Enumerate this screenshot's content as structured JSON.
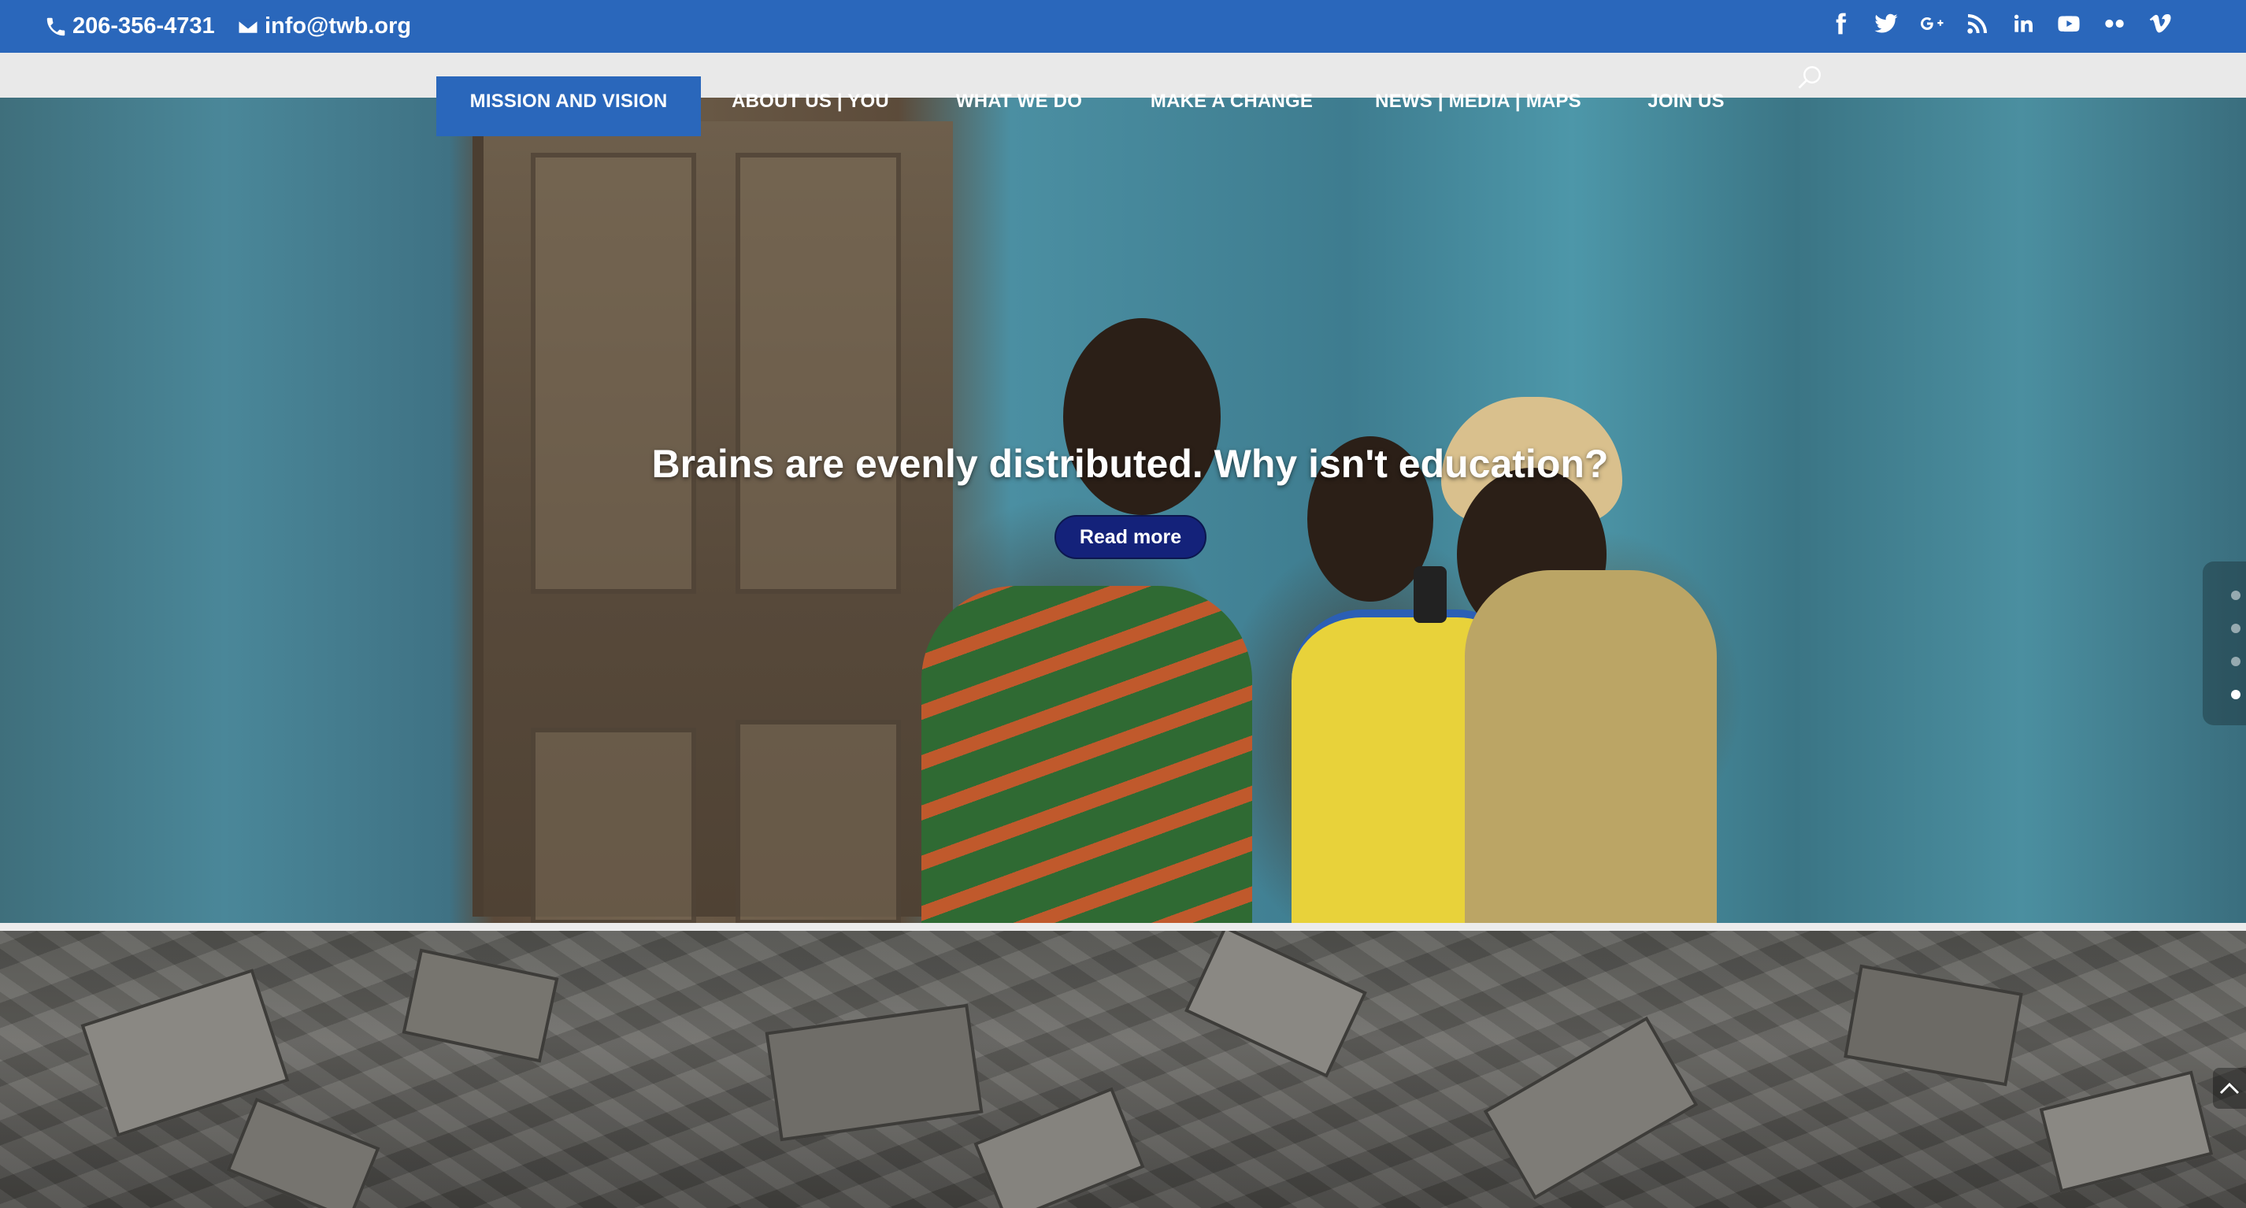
{
  "topbar": {
    "phone": "206-356-4731",
    "email": "info@twb.org",
    "social": [
      {
        "icon": "facebook-icon",
        "glyph": "f"
      },
      {
        "icon": "twitter-icon",
        "glyph": ""
      },
      {
        "icon": "google-plus-icon",
        "glyph": "G+"
      },
      {
        "icon": "rss-icon",
        "glyph": ""
      },
      {
        "icon": "linkedin-icon",
        "glyph": "in"
      },
      {
        "icon": "youtube-icon",
        "glyph": ""
      },
      {
        "icon": "flickr-icon",
        "glyph": ""
      },
      {
        "icon": "vimeo-icon",
        "glyph": "v"
      }
    ]
  },
  "nav": {
    "items": [
      {
        "label": "MISSION AND VISION",
        "active": true
      },
      {
        "label": "ABOUT US | YOU"
      },
      {
        "label": "WHAT WE DO"
      },
      {
        "label": "MAKE A CHANGE"
      },
      {
        "label": "NEWS | MEDIA | MAPS"
      },
      {
        "label": "JOIN US"
      }
    ],
    "search_icon": "search-icon"
  },
  "hero": {
    "title": "Brains are evenly distributed. Why isn't education?",
    "button_label": "Read more",
    "slides_total": 4,
    "active_slide": 4
  },
  "colors": {
    "topbar": "#2a67bb",
    "navbar": "#e9e9e9",
    "button": "#14227a"
  }
}
